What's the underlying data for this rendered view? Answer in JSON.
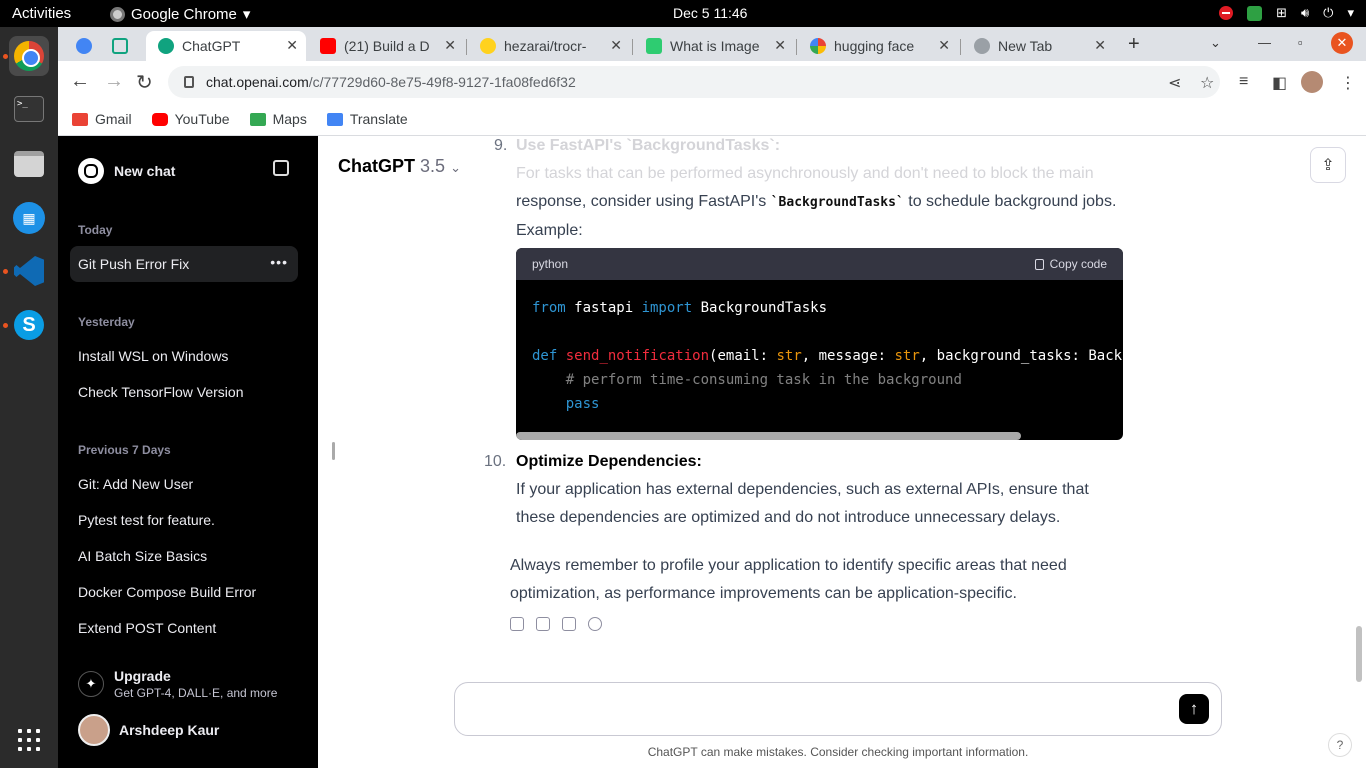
{
  "system": {
    "activities": "Activities",
    "app_menu": "Google Chrome",
    "clock": "Dec 5  11:46"
  },
  "tabs": [
    {
      "title": "ChatGPT",
      "favicon_color": "#10a37f"
    },
    {
      "title": "(21) Build a D",
      "favicon_color": "#ff0000"
    },
    {
      "title": "hezarai/trocr-",
      "favicon_color": "#ffd21e"
    },
    {
      "title": "What is Image",
      "favicon_color": "#2ecc71"
    },
    {
      "title": "hugging face",
      "favicon_color": "#4285f4"
    },
    {
      "title": "New Tab",
      "favicon_color": "#9aa0a6"
    }
  ],
  "address": {
    "domain": "chat.openai.com",
    "path": "/c/77729d60-8e75-49f8-9127-1fa08fed6f32"
  },
  "bookmarks": [
    {
      "label": "Gmail",
      "color": "#ea4335"
    },
    {
      "label": "YouTube",
      "color": "#ff0000"
    },
    {
      "label": "Maps",
      "color": "#34a853"
    },
    {
      "label": "Translate",
      "color": "#4285f4"
    }
  ],
  "sidebar": {
    "new_chat": "New chat",
    "sections": {
      "today": "Today",
      "yesterday": "Yesterday",
      "previous": "Previous 7 Days"
    },
    "today_items": [
      "Git Push Error Fix"
    ],
    "yesterday_items": [
      "Install WSL on Windows",
      "Check TensorFlow Version"
    ],
    "previous_items": [
      "Git: Add New User",
      "Pytest test for feature.",
      "AI Batch Size Basics",
      "Docker Compose Build Error",
      "Extend POST Content"
    ],
    "upgrade_title": "Upgrade",
    "upgrade_sub": "Get GPT-4, DALL·E, and more",
    "user_name": "Arshdeep Kaur"
  },
  "main": {
    "model_name": "ChatGPT",
    "model_version": "3.5",
    "item9_title": "Use FastAPI's `BackgroundTasks`:",
    "item9_line1": "For tasks that can be performed asynchronously and don't need to block the main",
    "item9_line2a": "response, consider using FastAPI's ",
    "item9_code": "`BackgroundTasks`",
    "item9_line2b": " to schedule background jobs.",
    "item9_line3": "Example:",
    "code_lang": "python",
    "copy_label": "Copy code",
    "item10_num": "10.",
    "item10_title": "Optimize Dependencies:",
    "item10_line1": "If your application has external dependencies, such as external APIs, ensure that",
    "item10_line2": "these dependencies are optimized and do not introduce unnecessary delays.",
    "closing_line1": "Always remember to profile your application to identify specific areas that need",
    "closing_line2": "optimization, as performance improvements can be application-specific.",
    "disclaimer": "ChatGPT can make mistakes. Consider checking important information.",
    "composer_placeholder": "",
    "help": "?"
  }
}
